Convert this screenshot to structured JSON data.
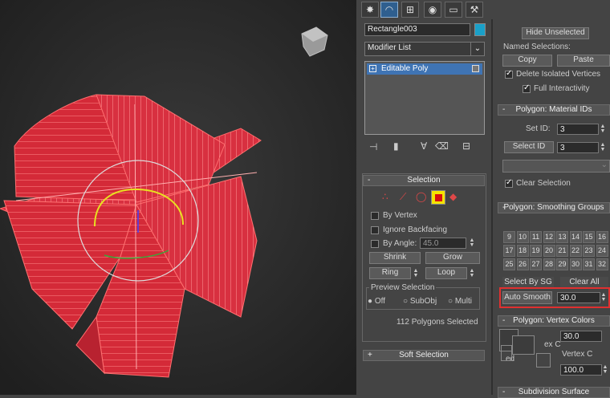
{
  "viewport": {
    "bg_color": "#2a2a2a",
    "mesh_color": "#e8323f"
  },
  "command_panel": {
    "tabs": [
      "create-icon",
      "modify-icon",
      "hierarchy-icon",
      "motion-icon",
      "display-icon",
      "utilities-icon"
    ],
    "active_tab": "modify-icon",
    "object_name": "Rectangle003",
    "object_color": "#1aa0c8",
    "modifier_list_label": "Modifier List",
    "stack": [
      {
        "label": "Editable Poly",
        "selected": true
      }
    ],
    "stack_tools": [
      "pin-stack-icon",
      "show-end-result-icon",
      "make-unique-icon",
      "remove-modifier-icon",
      "configure-sets-icon"
    ]
  },
  "selection": {
    "title": "Selection",
    "collapse_sign": "-",
    "by_vertex": "By Vertex",
    "ignore_backfacing": "Ignore Backfacing",
    "by_angle": "By Angle:",
    "by_angle_value": "45.0",
    "shrink": "Shrink",
    "grow": "Grow",
    "ring": "Ring",
    "loop": "Loop",
    "preview_title": "Preview Selection",
    "preview_options": [
      "Off",
      "SubObj",
      "Multi"
    ],
    "preview_selected": "Off",
    "status": "112 Polygons Selected"
  },
  "soft_selection": {
    "title": "Soft Selection",
    "sign": "+"
  },
  "right_col": {
    "hide_unselected": "Hide Unselected",
    "named_selections": "Named Selections:",
    "copy": "Copy",
    "paste": "Paste",
    "delete_isolated": "Delete Isolated Vertices",
    "full_interactivity": "Full Interactivity"
  },
  "material_ids": {
    "title": "Polygon: Material IDs",
    "sign": "-",
    "set_id": "Set ID:",
    "set_id_value": "3",
    "select_id": "Select ID",
    "select_id_value": "3",
    "clear_selection": "Clear Selection"
  },
  "smoothing_groups": {
    "title": "Polygon: Smoothing Groups",
    "sign": "-",
    "rows": [
      [
        "9",
        "10",
        "11",
        "12",
        "13",
        "14",
        "15",
        "16"
      ],
      [
        "17",
        "18",
        "19",
        "20",
        "21",
        "22",
        "23",
        "24"
      ],
      [
        "25",
        "26",
        "27",
        "28",
        "29",
        "30",
        "31",
        "32"
      ]
    ],
    "select_by_sg": "Select By SG",
    "clear_all": "Clear All",
    "auto_smooth": "Auto Smooth",
    "auto_smooth_value": "30.0",
    "highlight_color": "#e03030"
  },
  "vertex_colors": {
    "title": "Polygon: Vertex Colors",
    "sign": "-",
    "value_a": "30.0",
    "partial_a": "ex C",
    "partial_b": "Vertex C",
    "partial_c": "ed",
    "value_b": "100.0"
  },
  "subdivision": {
    "title": "Subdivision Surface",
    "sign": "-"
  }
}
